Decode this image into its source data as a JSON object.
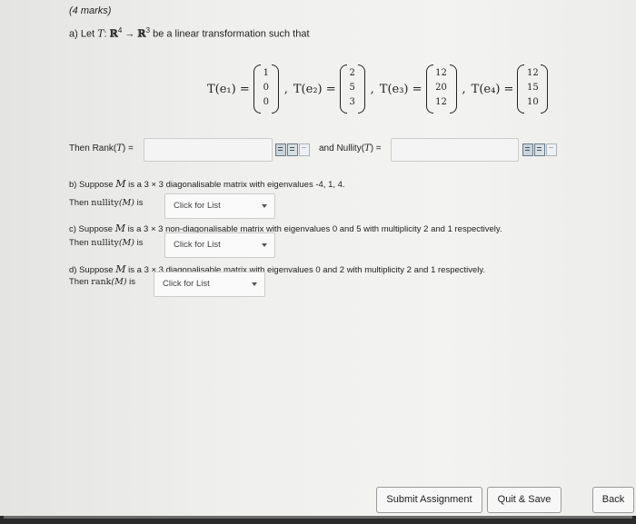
{
  "header": {
    "marks": "(4 marks)"
  },
  "part_a": {
    "prefix": "a) Let",
    "T": "T",
    "colon": ":",
    "domain": "ℝ",
    "domain_exp": "4",
    "arrow": "→",
    "codomain": "ℝ",
    "codomain_exp": "3",
    "suffix": "be a linear transformation such that",
    "vectors": [
      {
        "label": "T(e₁) =",
        "values": [
          "1",
          "0",
          "0"
        ]
      },
      {
        "label": "T(e₂) =",
        "values": [
          "2",
          "5",
          "3"
        ]
      },
      {
        "label": "T(e₃) =",
        "values": [
          "12",
          "20",
          "12"
        ]
      },
      {
        "label": "T(e₄) =",
        "values": [
          "12",
          "15",
          "10"
        ]
      }
    ],
    "rank_label": "Then Rank(",
    "rank_T": "T",
    "rank_close": ") =",
    "nullity_label": "and Nullity(",
    "nullity_T": "T",
    "nullity_close": ") =",
    "rank_value": "",
    "nullity_value": ""
  },
  "part_b": {
    "text_pre": "b) Suppose",
    "M": "M",
    "text_mid": "is a 3 × 3 diagonalisable matrix with eigenvalues -4, 1, 4.",
    "then": "Then",
    "fn": "nullity",
    "arg": "(M)",
    "is": "is",
    "select": "Click for List"
  },
  "part_c": {
    "text_pre": "c) Suppose",
    "M": "M",
    "text_mid": "is a 3 × 3 non-diagonalisable matrix with eigenvalues 0 and 5 with multiplicity 2 and 1 respectively.",
    "then": "Then",
    "fn": "nullity",
    "arg": "(M)",
    "is": "is",
    "select": "Click for List"
  },
  "part_d": {
    "text_pre": "d) Suppose",
    "M": "M",
    "text_mid": "is a 3 × 3 diagonalisable matrix with eigenvalues 0 and 2 with multiplicity 2 and 1 respectively.",
    "then": "Then",
    "fn": "rank",
    "arg": "(M)",
    "is": "is",
    "select": "Click for List"
  },
  "buttons": {
    "submit": "Submit Assignment",
    "quit": "Quit & Save",
    "back": "Back"
  }
}
